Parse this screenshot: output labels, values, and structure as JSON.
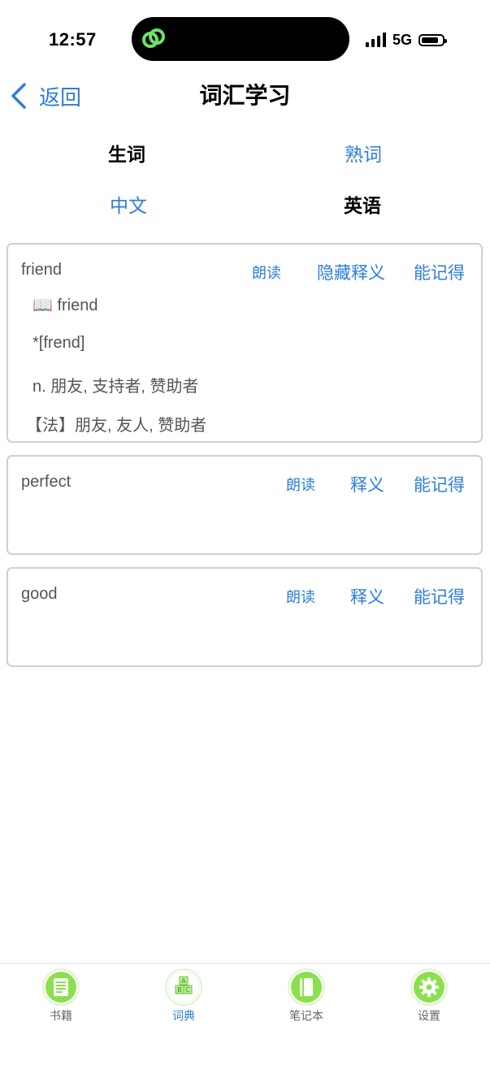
{
  "status": {
    "time": "12:57",
    "network": "5G"
  },
  "nav": {
    "back_label": "返回",
    "title": "词汇学习"
  },
  "filters": {
    "row1": {
      "left": "生词",
      "right": "熟词"
    },
    "row2": {
      "left": "中文",
      "right": "英语"
    }
  },
  "cards": [
    {
      "word": "friend",
      "read": "朗读",
      "toggle": "隐藏释义",
      "remember": "能记得",
      "details": [
        "📖 friend",
        "*[frend]",
        "n. 朋友, 支持者, 赞助者",
        "【法】朋友, 友人, 赞助者"
      ]
    },
    {
      "word": "perfect",
      "read": "朗读",
      "toggle": "释义",
      "remember": "能记得"
    },
    {
      "word": "good",
      "read": "朗读",
      "toggle": "释义",
      "remember": "能记得"
    }
  ],
  "tabs": [
    {
      "label": "书籍",
      "icon": "book-icon"
    },
    {
      "label": "词典",
      "icon": "abc-blocks-icon"
    },
    {
      "label": "笔记本",
      "icon": "notebook-icon"
    },
    {
      "label": "设置",
      "icon": "gear-icon"
    }
  ],
  "colors": {
    "accent": "#2d7ddc",
    "tab_green": "#8be04e",
    "border": "#cfcfcf"
  }
}
